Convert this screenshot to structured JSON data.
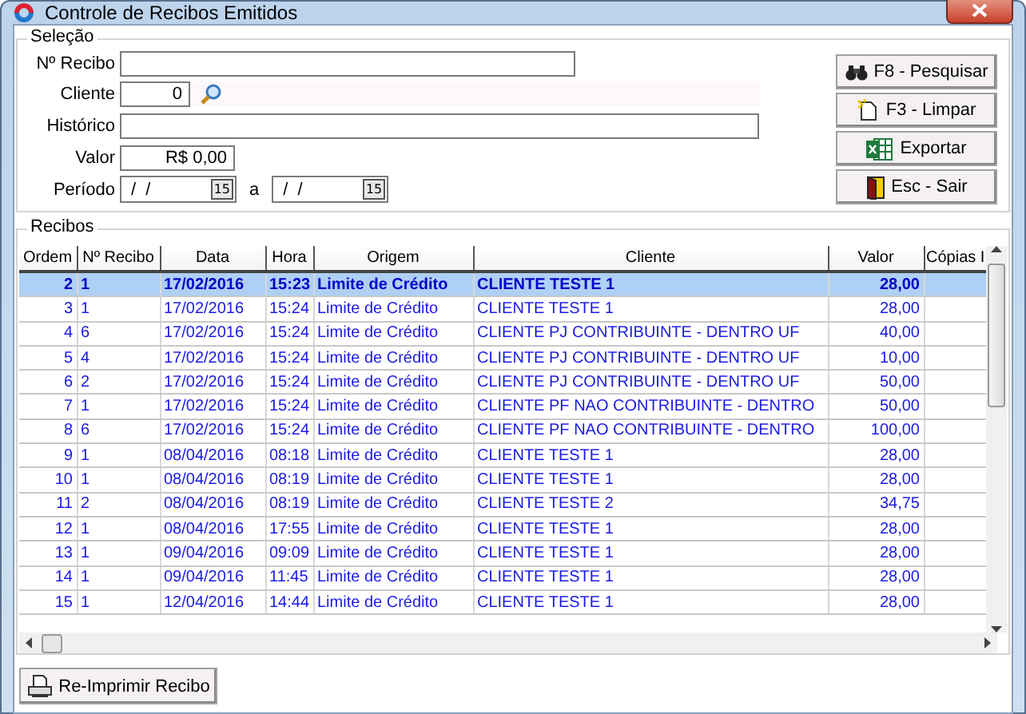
{
  "window": {
    "title": "Controle de Recibos Emitidos"
  },
  "selection": {
    "title": "Seleção",
    "recibo": {
      "label": "Nº Recibo"
    },
    "cliente": {
      "label": "Cliente",
      "value": "0"
    },
    "historico": {
      "label": "Histórico"
    },
    "valor": {
      "label": "Valor",
      "value": "R$ 0,00"
    },
    "periodo": {
      "label": "Período",
      "from": "/  /",
      "from_calendar": "15",
      "separator": "a",
      "to": "/  /",
      "to_calendar": "15"
    }
  },
  "actions": [
    {
      "label": "F8 - Pesquisar",
      "kind": "search"
    },
    {
      "label": "F3 - Limpar",
      "kind": "clear"
    },
    {
      "label": "Exportar",
      "kind": "export"
    },
    {
      "label": "Esc - Sair",
      "kind": "exit"
    }
  ],
  "receipts": {
    "title": "Recibos",
    "columns": [
      "Ordem",
      "Nº Recibo",
      "Data",
      "Hora",
      "Origem",
      "Cliente",
      "Valor",
      "Cópias I"
    ],
    "rows": [
      {
        "selected": true,
        "cells": [
          "2",
          "1",
          "17/02/2016",
          "15:23",
          "Limite de Crédito",
          "CLIENTE TESTE 1",
          "28,00"
        ]
      },
      {
        "selected": false,
        "cells": [
          "3",
          "1",
          "17/02/2016",
          "15:24",
          "Limite de Crédito",
          "CLIENTE TESTE 1",
          "28,00"
        ]
      },
      {
        "selected": false,
        "cells": [
          "4",
          "6",
          "17/02/2016",
          "15:24",
          "Limite de Crédito",
          "CLIENTE PJ CONTRIBUINTE - DENTRO UF",
          "40,00"
        ]
      },
      {
        "selected": false,
        "cells": [
          "5",
          "4",
          "17/02/2016",
          "15:24",
          "Limite de Crédito",
          "CLIENTE PJ CONTRIBUINTE - DENTRO UF",
          "10,00"
        ]
      },
      {
        "selected": false,
        "cells": [
          "6",
          "2",
          "17/02/2016",
          "15:24",
          "Limite de Crédito",
          "CLIENTE PJ CONTRIBUINTE - DENTRO UF",
          "50,00"
        ]
      },
      {
        "selected": false,
        "cells": [
          "7",
          "1",
          "17/02/2016",
          "15:24",
          "Limite de Crédito",
          "CLIENTE PF NAO CONTRIBUINTE - DENTRO",
          "50,00"
        ]
      },
      {
        "selected": false,
        "cells": [
          "8",
          "6",
          "17/02/2016",
          "15:24",
          "Limite de Crédito",
          "CLIENTE PF NAO CONTRIBUINTE - DENTRO",
          "100,00"
        ]
      },
      {
        "selected": false,
        "cells": [
          "9",
          "1",
          "08/04/2016",
          "08:18",
          "Limite de Crédito",
          "CLIENTE TESTE 1",
          "28,00"
        ]
      },
      {
        "selected": false,
        "cells": [
          "10",
          "1",
          "08/04/2016",
          "08:19",
          "Limite de Crédito",
          "CLIENTE TESTE 1",
          "28,00"
        ]
      },
      {
        "selected": false,
        "cells": [
          "11",
          "2",
          "08/04/2016",
          "08:19",
          "Limite de Crédito",
          "CLIENTE TESTE 2",
          "34,75"
        ]
      },
      {
        "selected": false,
        "cells": [
          "12",
          "1",
          "08/04/2016",
          "17:55",
          "Limite de Crédito",
          "CLIENTE TESTE 1",
          "28,00"
        ]
      },
      {
        "selected": false,
        "cells": [
          "13",
          "1",
          "09/04/2016",
          "09:09",
          "Limite de Crédito",
          "CLIENTE TESTE 1",
          "28,00"
        ]
      },
      {
        "selected": false,
        "cells": [
          "14",
          "1",
          "09/04/2016",
          "11:45",
          "Limite de Crédito",
          "CLIENTE TESTE 1",
          "28,00"
        ]
      },
      {
        "selected": false,
        "cells": [
          "15",
          "1",
          "12/04/2016",
          "14:44",
          "Limite de Crédito",
          "CLIENTE TESTE 1",
          "28,00"
        ]
      }
    ]
  },
  "footer": {
    "button": "Re-Imprimir Recibo"
  }
}
